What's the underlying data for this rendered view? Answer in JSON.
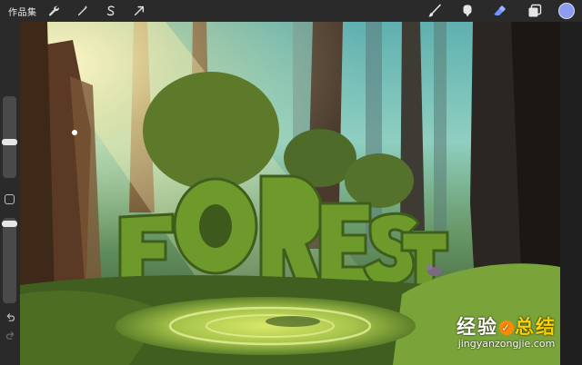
{
  "toolbar": {
    "gallery_label": "作品集",
    "left_tools": [
      {
        "name": "wrench-icon"
      },
      {
        "name": "magic-wand-icon"
      },
      {
        "name": "selection-s-icon"
      },
      {
        "name": "transform-arrow-icon"
      }
    ],
    "right_tools": [
      {
        "name": "brush-icon"
      },
      {
        "name": "smudge-icon"
      },
      {
        "name": "eraser-icon"
      },
      {
        "name": "layers-icon"
      }
    ],
    "current_color": "#8c9cf0"
  },
  "sidebar": {
    "brush_size_slider": {
      "name": "brush-size-slider"
    },
    "opacity_slider": {
      "name": "opacity-slider"
    },
    "modify_button": {
      "name": "modify-button"
    },
    "undo": {
      "name": "undo-icon"
    },
    "redo": {
      "name": "redo-icon"
    }
  },
  "canvas": {
    "artwork_text": "FOREST"
  },
  "watermark": {
    "title_part1": "经验",
    "title_part2": "总结",
    "url": "jingyanzongjie.com"
  },
  "colors": {
    "accent": "#8c9cf0",
    "eraser_active": "#6f93ff",
    "toolbar_bg": "#2a2a2a"
  }
}
